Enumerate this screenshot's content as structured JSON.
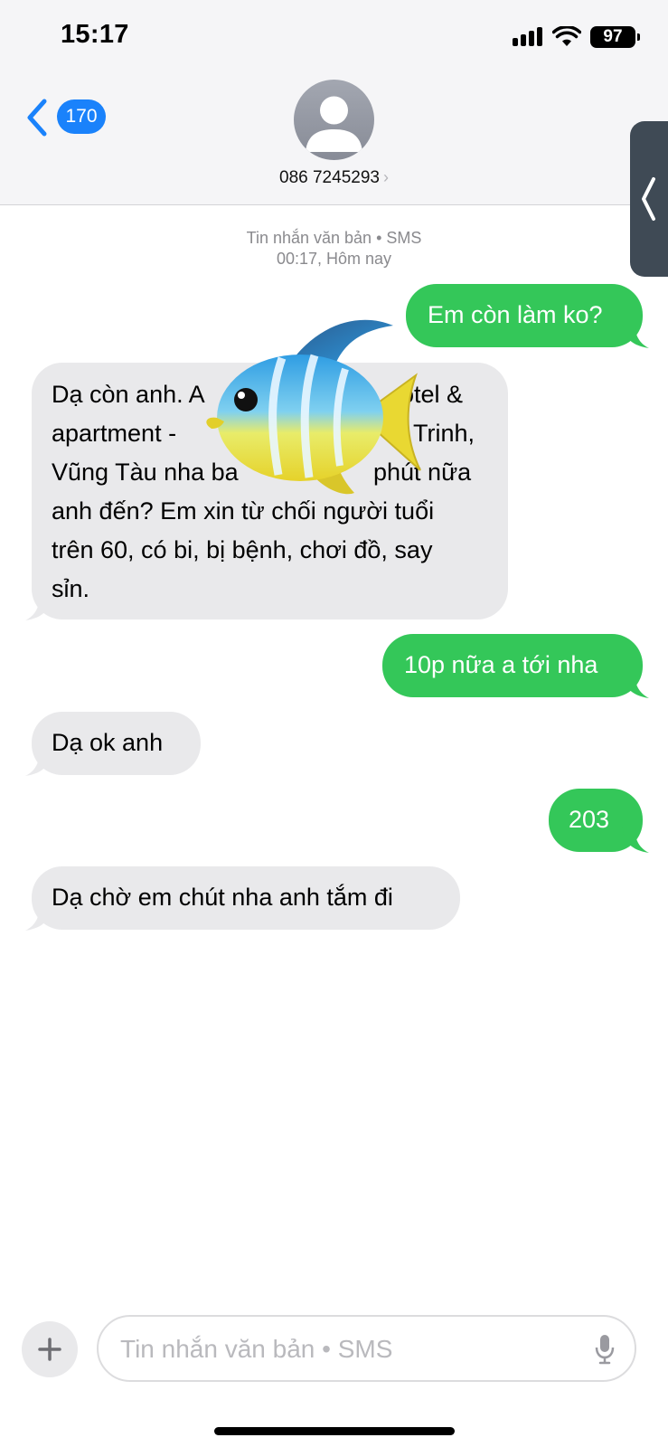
{
  "status_bar": {
    "time": "15:17",
    "battery": "97"
  },
  "header": {
    "back_count": "170",
    "contact": "086 7245293",
    "contact_chevron": "›"
  },
  "thread": {
    "service": "Tin nhắn văn bản • SMS",
    "timestamp": "00:17, Hôm nay"
  },
  "messages": [
    {
      "direction": "out",
      "text": "Em còn làm ko?"
    },
    {
      "direction": "in",
      "lines": [
        "Dạ còn anh. A",
        "otel &",
        "apartment -",
        "Trinh,",
        "Vũng Tàu nha ba",
        "phút nữa",
        "anh đến? Em xin từ chối người tuổi",
        "trên 60, có bi, bị bệnh, chơi đồ, say",
        "sỉn."
      ]
    },
    {
      "direction": "out",
      "text": "10p nữa a tới nha"
    },
    {
      "direction": "in",
      "text": "Dạ ok anh"
    },
    {
      "direction": "out",
      "text": "203"
    },
    {
      "direction": "in",
      "text": "Dạ chờ em chút nha anh tắm đi"
    }
  ],
  "composer": {
    "placeholder": "Tin nhắn văn bản • SMS"
  },
  "icons": {
    "back": "chevron-left-icon",
    "avatar": "person-icon",
    "add": "plus-icon",
    "mic": "microphone-icon",
    "overlay": "fish-emoji"
  },
  "colors": {
    "outgoing_bubble": "#34c759",
    "incoming_bubble": "#e9e9eb",
    "accent": "#1a82fb"
  }
}
